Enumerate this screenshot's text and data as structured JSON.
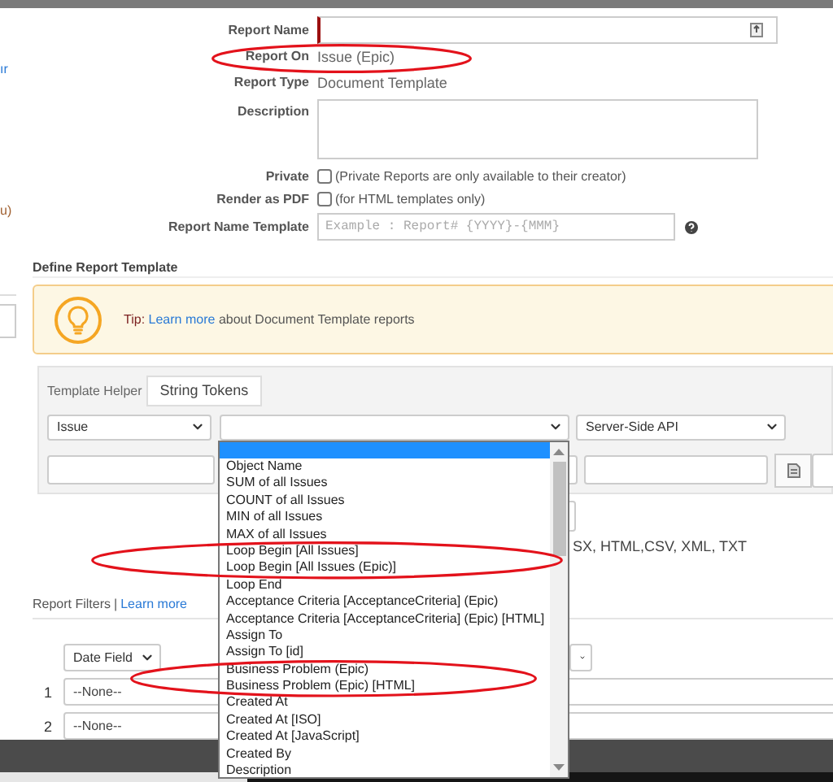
{
  "left_fragments": [
    {
      "kind": "link",
      "text": "ır"
    },
    {
      "kind": "text",
      "text": "u)"
    }
  ],
  "report_form": [
    {
      "label": "Report Name",
      "kind": "name_input"
    },
    {
      "label": "Report On",
      "kind": "text",
      "value": "Issue (Epic)"
    },
    {
      "label": "Report Type",
      "kind": "text",
      "value": "Document Template"
    },
    {
      "label": "Description",
      "kind": "textarea"
    },
    {
      "label": "Private",
      "kind": "checkbox",
      "checked": false,
      "note": "(Private Reports are only available to their creator)"
    },
    {
      "label": "Render as PDF",
      "kind": "checkbox",
      "checked": false,
      "note": "(for HTML templates only)"
    },
    {
      "label": "Report Name Template",
      "kind": "template_input",
      "placeholder": "Example : Report# {YYYY}-{MMM}"
    }
  ],
  "define_template": {
    "title": "Define Report Template",
    "tip": {
      "prefix": "Tip:",
      "link": "Learn more",
      "text": "about Document Template reports"
    }
  },
  "template_helper": {
    "label": "Template Helper",
    "tab": "String Tokens",
    "selects": [
      {
        "value": "Issue"
      },
      {
        "kind": "open"
      },
      {
        "value": "Server-Side API"
      }
    ]
  },
  "formats_text": "SX, HTML,CSV, XML, TXT",
  "report_filters": {
    "title": "Report Filters",
    "separator": "|",
    "link": "Learn more",
    "date_field": "Date Field",
    "rows": [
      {
        "number": "1",
        "value": "--None--"
      },
      {
        "number": "2",
        "value": "--None--"
      }
    ]
  },
  "dropdown": {
    "blank_option_selected": true,
    "options": [
      {
        "label": "Object Name",
        "selected": false
      },
      {
        "label": "SUM of all Issues",
        "selected": false
      },
      {
        "label": "COUNT of all Issues",
        "selected": false
      },
      {
        "label": "MIN of all Issues",
        "selected": false
      },
      {
        "label": "MAX of all Issues",
        "selected": false
      },
      {
        "label": "Loop Begin [All Issues]",
        "selected": false
      },
      {
        "label": "Loop Begin [All Issues (Epic)]",
        "selected": false
      },
      {
        "label": "Loop End",
        "selected": false
      },
      {
        "label": "Acceptance Criteria [AcceptanceCriteria] (Epic)",
        "selected": false
      },
      {
        "label": "Acceptance Criteria [AcceptanceCriteria] (Epic) [HTML]",
        "selected": false
      },
      {
        "label": "Assign To",
        "selected": false
      },
      {
        "label": "Assign To [id]",
        "selected": false
      },
      {
        "label": "Business Problem (Epic)",
        "selected": false
      },
      {
        "label": "Business Problem (Epic) [HTML]",
        "selected": false
      },
      {
        "label": "Created At",
        "selected": false
      },
      {
        "label": "Created At [ISO]",
        "selected": false
      },
      {
        "label": "Created At [JavaScript]",
        "selected": false
      },
      {
        "label": "Created By",
        "selected": false
      },
      {
        "label": "Description",
        "selected": false
      }
    ]
  },
  "annotations": [
    {
      "kind": "ellipse",
      "color": "#e3121b"
    },
    {
      "kind": "ellipse",
      "color": "#e3121b"
    },
    {
      "kind": "ellipse",
      "color": "#e3121b"
    }
  ]
}
